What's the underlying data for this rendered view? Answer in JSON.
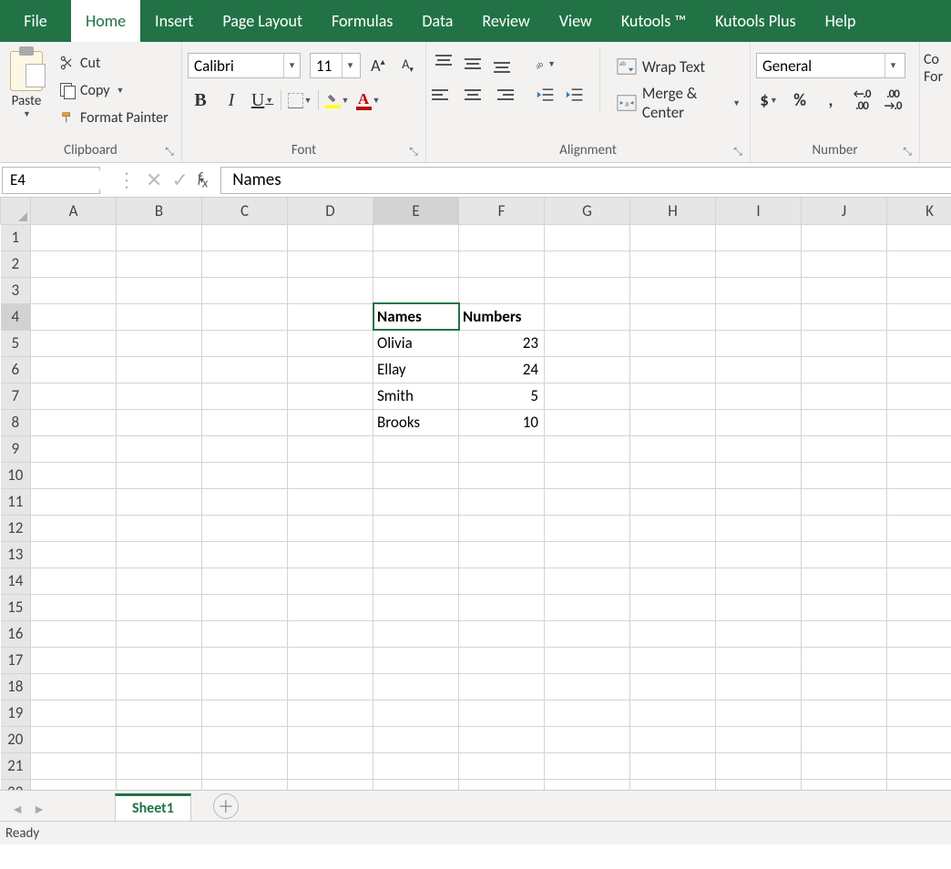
{
  "tabs": {
    "file": "File",
    "home": "Home",
    "insert": "Insert",
    "page_layout": "Page Layout",
    "formulas": "Formulas",
    "data": "Data",
    "review": "Review",
    "view": "View",
    "kutools": "Kutools ™",
    "kutools_plus": "Kutools Plus",
    "help": "Help"
  },
  "clipboard": {
    "paste": "Paste",
    "cut": "Cut",
    "copy": "Copy",
    "format_painter": "Format Painter",
    "group_label": "Clipboard"
  },
  "font": {
    "name": "Calibri",
    "size": "11",
    "group_label": "Font"
  },
  "alignment": {
    "wrap": "Wrap Text",
    "merge": "Merge & Center",
    "group_label": "Alignment"
  },
  "number": {
    "format": "General",
    "group_label": "Number"
  },
  "cond": {
    "label1": "Co",
    "label2": "For"
  },
  "namebox": "E4",
  "formula": "Names",
  "columns": [
    "A",
    "B",
    "C",
    "D",
    "E",
    "F",
    "G",
    "H",
    "I",
    "J",
    "K"
  ],
  "row_count": 22,
  "selected_cell": {
    "row": 4,
    "col": "E"
  },
  "cells": {
    "E4": {
      "v": "Names",
      "bold": true,
      "align": "left"
    },
    "F4": {
      "v": "Numbers",
      "bold": true,
      "align": "left"
    },
    "E5": {
      "v": "Olivia",
      "align": "left"
    },
    "F5": {
      "v": "23",
      "align": "right"
    },
    "E6": {
      "v": "Ellay",
      "align": "left"
    },
    "F6": {
      "v": "24",
      "align": "right"
    },
    "E7": {
      "v": "Smith",
      "align": "left"
    },
    "F7": {
      "v": "5",
      "align": "right"
    },
    "E8": {
      "v": "Brooks",
      "align": "left"
    },
    "F8": {
      "v": "10",
      "align": "right"
    }
  },
  "sheet": {
    "name": "Sheet1"
  },
  "status": "Ready"
}
